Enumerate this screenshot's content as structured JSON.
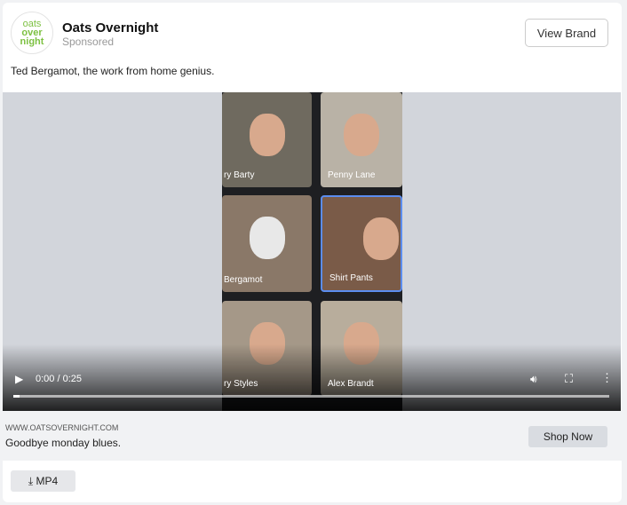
{
  "header": {
    "logo_lines": [
      "oats",
      "over",
      "night"
    ],
    "brand": "Oats Overnight",
    "sponsored": "Sponsored",
    "view_brand": "View Brand"
  },
  "caption": "Ted Bergamot, the work from home genius.",
  "video": {
    "participants": [
      "ry Barty",
      "Penny Lane",
      "Bergamot",
      "Shirt Pants",
      "ry Styles",
      "Alex Brandt"
    ],
    "time": "0:00 / 0:25",
    "progress": 0.01
  },
  "footer": {
    "url": "WWW.OATSOVERNIGHT.COM",
    "description": "Goodbye monday blues.",
    "cta": "Shop Now"
  },
  "download": {
    "label": "MP4"
  }
}
